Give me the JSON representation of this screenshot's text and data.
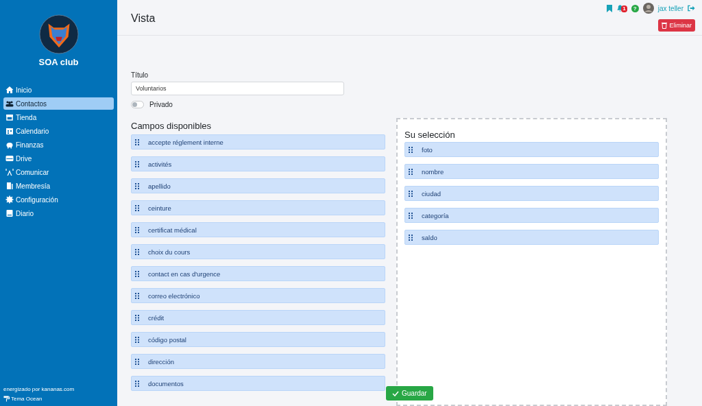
{
  "sidebar": {
    "club_name": "SOA club",
    "items": [
      {
        "label": "Inicio",
        "selected": false
      },
      {
        "label": "Contactos",
        "selected": true
      },
      {
        "label": "Tienda",
        "selected": false
      },
      {
        "label": "Calendario",
        "selected": false
      },
      {
        "label": "Finanzas",
        "selected": false
      },
      {
        "label": "Drive",
        "selected": false
      },
      {
        "label": "Comunicar",
        "selected": false
      },
      {
        "label": "Membresía",
        "selected": false
      },
      {
        "label": "Configuración",
        "selected": false
      },
      {
        "label": "Diario",
        "selected": false
      }
    ],
    "powered_by": "energizado por kananas.com",
    "theme": "Tema Ocean"
  },
  "header": {
    "title": "Vista",
    "notification_count": "1",
    "help": "?",
    "user": "jax teller",
    "delete_button": "Eliminar"
  },
  "form": {
    "title_label": "Título",
    "title_value": "Voluntarios",
    "private_label": "Privado",
    "private_on": false
  },
  "available": {
    "heading": "Campos disponibles",
    "fields": [
      "accepte réglement interne",
      "activités",
      "apellido",
      "ceinture",
      "certificat médical",
      "choix du cours",
      "contact en cas d'urgence",
      "correo electrónico",
      "crédit",
      "código postal",
      "dirección",
      "documentos"
    ]
  },
  "selection": {
    "heading": "Su selección",
    "fields": [
      "foto",
      "nombre",
      "ciudad",
      "categoría",
      "saldo"
    ]
  },
  "save_button": "Guardar"
}
